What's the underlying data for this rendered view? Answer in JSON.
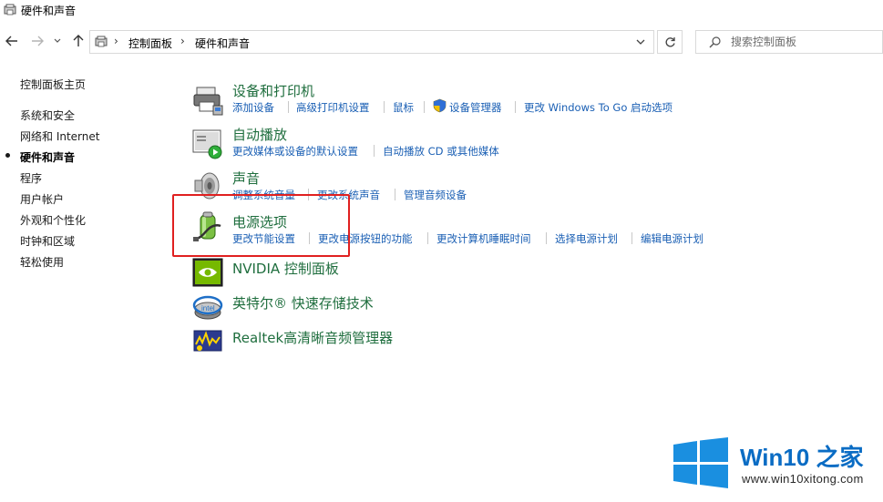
{
  "window": {
    "title": "硬件和声音"
  },
  "nav": {
    "breadcrumb": [
      "控制面板",
      "硬件和声音"
    ],
    "search_placeholder": "搜索控制面板"
  },
  "sidebar": {
    "items": [
      {
        "label": "控制面板主页"
      },
      {
        "label": "系统和安全"
      },
      {
        "label": "网络和 Internet"
      },
      {
        "label": "硬件和声音",
        "active": true
      },
      {
        "label": "程序"
      },
      {
        "label": "用户帐户"
      },
      {
        "label": "外观和个性化"
      },
      {
        "label": "时钟和区域"
      },
      {
        "label": "轻松使用"
      }
    ]
  },
  "categories": [
    {
      "title": "设备和打印机",
      "icon": "printer-icon",
      "links": [
        "添加设备",
        "高级打印机设置",
        "鼠标",
        "设备管理器",
        "更改 Windows To Go 启动选项"
      ]
    },
    {
      "title": "自动播放",
      "icon": "autoplay-icon",
      "links": [
        "更改媒体或设备的默认设置",
        "自动播放 CD 或其他媒体"
      ]
    },
    {
      "title": "声音",
      "icon": "speaker-icon",
      "links": [
        "调整系统音量",
        "更改系统声音",
        "管理音频设备"
      ]
    },
    {
      "title": "电源选项",
      "icon": "battery-icon",
      "links": [
        "更改节能设置",
        "更改电源按钮的功能",
        "更改计算机睡眠时间",
        "选择电源计划",
        "编辑电源计划"
      ]
    },
    {
      "title": "NVIDIA 控制面板",
      "icon": "nvidia-icon",
      "links": []
    },
    {
      "title": "英特尔® 快速存储技术",
      "icon": "intel-rst-icon",
      "links": []
    },
    {
      "title": "Realtek高清晰音频管理器",
      "icon": "realtek-audio-icon",
      "links": []
    }
  ],
  "watermark": {
    "title": "Win10 之家",
    "url": "www.win10xitong.com",
    "colors": {
      "logo": "#1a8fe0",
      "title": "#0a6cc4"
    }
  },
  "colors": {
    "category_title": "#1f6e3e",
    "link": "#1a5fb4",
    "highlight": "#e02020"
  }
}
